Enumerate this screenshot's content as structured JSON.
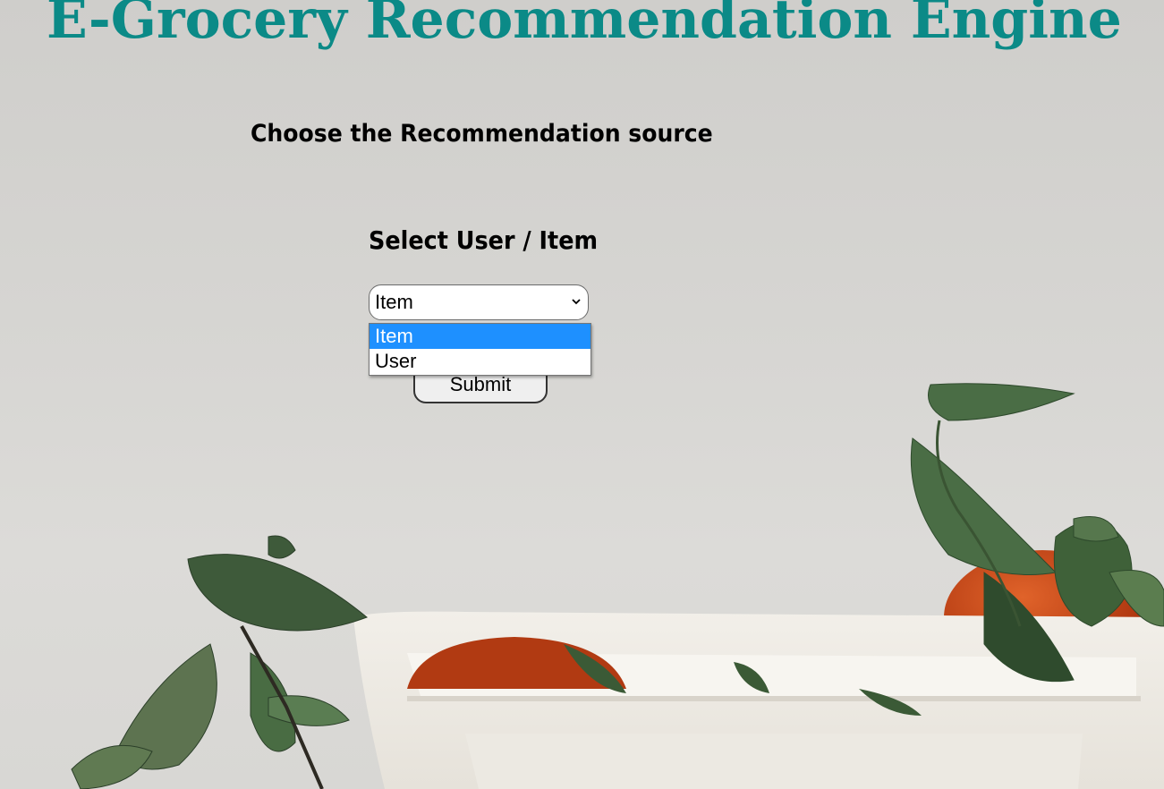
{
  "header": {
    "title": "E-Grocery Recommendation Engine"
  },
  "main": {
    "section_heading": "Choose the Recommendation source",
    "select_label": "Select User / Item",
    "select": {
      "value": "Item",
      "options": [
        "Item",
        "User"
      ],
      "highlighted_option": "Item"
    },
    "submit_label": "Submit"
  },
  "colors": {
    "title": "#0b8a87",
    "highlight": "#1e90ff",
    "background": "#d6d5d2"
  },
  "icons": {
    "select_arrow": "chevron-down-icon"
  }
}
